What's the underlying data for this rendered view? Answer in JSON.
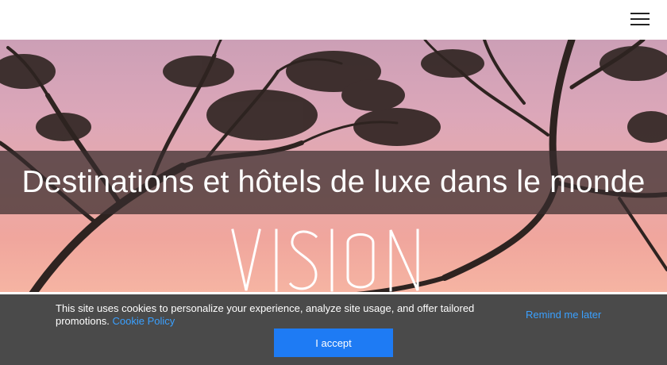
{
  "header": {
    "menu_icon": "hamburger-menu-icon"
  },
  "hero": {
    "title": "Destinations et hôtels de luxe dans le monde",
    "logo_text": "VISION",
    "colors": {
      "sky_top": "#cc9fb6",
      "sky_bottom": "#f6b5a3",
      "band": "#372d2d",
      "tree": "#2e2320"
    }
  },
  "cookie_banner": {
    "message": "This site uses cookies to personalize your experience, analyze site usage, and offer tailored promotions.",
    "policy_link": "Cookie Policy",
    "remind_label": "Remind me later",
    "accept_label": "I accept",
    "colors": {
      "background": "#4a4a4a",
      "link": "#3aa0ff",
      "button": "#1e7bf4"
    }
  }
}
